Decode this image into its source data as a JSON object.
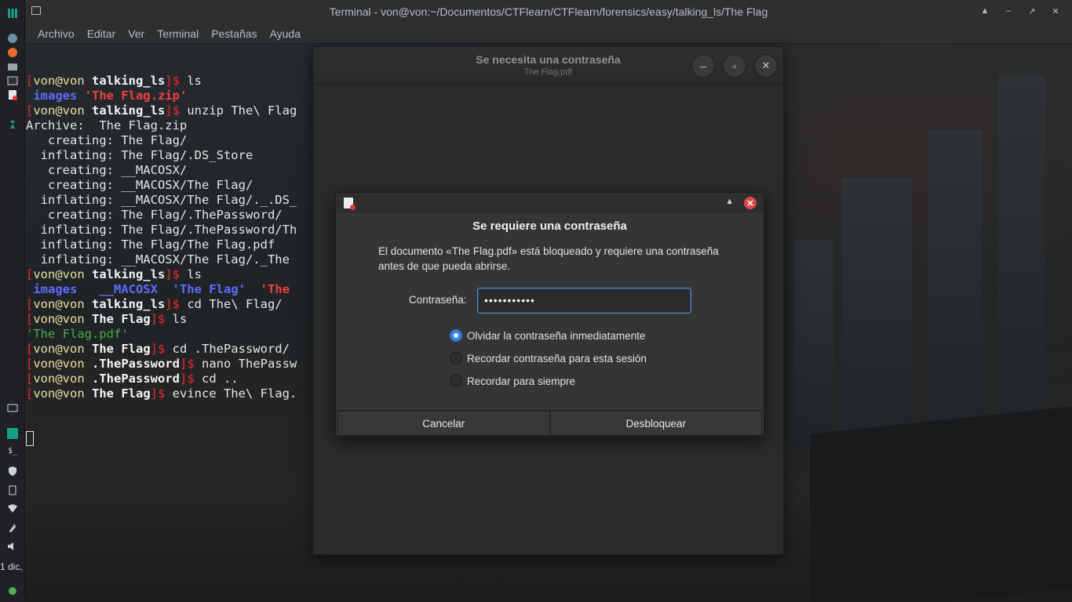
{
  "terminal": {
    "title": "Terminal - von@von:~/Documentos/CTFlearn/CTFlearn/forensics/easy/talking_ls/The Flag",
    "menu": [
      "Archivo",
      "Editar",
      "Ver",
      "Terminal",
      "Pestañas",
      "Ayuda"
    ],
    "lines": [
      [
        [
          "[",
          "br"
        ],
        [
          "von@von ",
          "u"
        ],
        [
          "talking_ls",
          "path"
        ],
        [
          "]$ ",
          "br"
        ],
        [
          "ls",
          ""
        ]
      ],
      [
        [
          " images ",
          "dir"
        ],
        [
          "'The Flag.zip'",
          "red"
        ]
      ],
      [
        [
          "[",
          "br"
        ],
        [
          "von@von ",
          "u"
        ],
        [
          "talking_ls",
          "path"
        ],
        [
          "]$ ",
          "br"
        ],
        [
          "unzip The\\ Flag",
          ""
        ]
      ],
      [
        [
          "Archive:  The Flag.zip",
          ""
        ]
      ],
      [
        [
          "   creating: The Flag/",
          ""
        ]
      ],
      [
        [
          "  inflating: The Flag/.DS_Store",
          ""
        ]
      ],
      [
        [
          "   creating: __MACOSX/",
          ""
        ]
      ],
      [
        [
          "   creating: __MACOSX/The Flag/",
          ""
        ]
      ],
      [
        [
          "  inflating: __MACOSX/The Flag/._.DS_",
          ""
        ]
      ],
      [
        [
          "   creating: The Flag/.ThePassword/",
          ""
        ]
      ],
      [
        [
          "  inflating: The Flag/.ThePassword/Th",
          ""
        ]
      ],
      [
        [
          "  inflating: The Flag/The Flag.pdf",
          ""
        ]
      ],
      [
        [
          "  inflating: __MACOSX/The Flag/._The",
          ""
        ]
      ],
      [
        [
          "[",
          "br"
        ],
        [
          "von@von ",
          "u"
        ],
        [
          "talking_ls",
          "path"
        ],
        [
          "]$ ",
          "br"
        ],
        [
          "ls",
          ""
        ]
      ],
      [
        [
          " images ",
          "dir"
        ],
        [
          "  __MACOSX ",
          "dir"
        ],
        [
          " 'The Flag' ",
          "dir"
        ],
        [
          " 'The",
          "red"
        ]
      ],
      [
        [
          "[",
          "br"
        ],
        [
          "von@von ",
          "u"
        ],
        [
          "talking_ls",
          "path"
        ],
        [
          "]$ ",
          "br"
        ],
        [
          "cd The\\ Flag/",
          ""
        ]
      ],
      [
        [
          "[",
          "br"
        ],
        [
          "von@von ",
          "u"
        ],
        [
          "The Flag",
          "path"
        ],
        [
          "]$ ",
          "br"
        ],
        [
          "ls",
          ""
        ]
      ],
      [
        [
          "'The Flag.pdf'",
          "green"
        ]
      ],
      [
        [
          "[",
          "br"
        ],
        [
          "von@von ",
          "u"
        ],
        [
          "The Flag",
          "path"
        ],
        [
          "]$ ",
          "br"
        ],
        [
          "cd .ThePassword/",
          ""
        ]
      ],
      [
        [
          "[",
          "br"
        ],
        [
          "von@von ",
          "u"
        ],
        [
          ".ThePassword",
          "path"
        ],
        [
          "]$ ",
          "br"
        ],
        [
          "nano ThePassw",
          ""
        ]
      ],
      [
        [
          "[",
          "br"
        ],
        [
          "von@von ",
          "u"
        ],
        [
          ".ThePassword",
          "path"
        ],
        [
          "]$ ",
          "br"
        ],
        [
          "cd ..",
          ""
        ]
      ],
      [
        [
          "[",
          "br"
        ],
        [
          "von@von ",
          "u"
        ],
        [
          "The Flag",
          "path"
        ],
        [
          "]$ ",
          "br"
        ],
        [
          "evince The\\ Flag.",
          ""
        ]
      ]
    ]
  },
  "evince": {
    "title": "Se necesita una contraseña",
    "subtitle": "The Flag.pdf"
  },
  "dialog": {
    "heading": "Se requiere una contraseña",
    "message": "El documento «The Flag.pdf» está bloqueado y requiere una contraseña antes de que pueda abrirse.",
    "password_label": "Contraseña:",
    "password_value": "•••••••••••",
    "options": [
      {
        "label": "Olvidar la contraseña inmediatamente",
        "checked": true
      },
      {
        "label": "Recordar contraseña para esta sesión",
        "checked": false
      },
      {
        "label": "Recordar para siempre",
        "checked": false
      }
    ],
    "cancel_label": "Cancelar",
    "unlock_label": "Desbloquear"
  },
  "panel": {
    "clock": "1 dic,"
  },
  "colors": {
    "accent": "#3584e4",
    "prompt_bracket": "#ef2929",
    "directory": "#5c6cff"
  }
}
